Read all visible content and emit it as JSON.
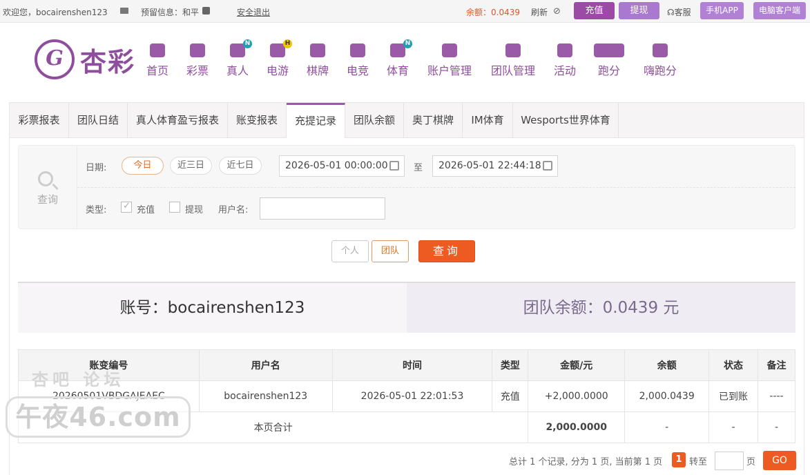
{
  "topbar": {
    "welcome": "欢迎您，bocairenshen123",
    "reserved": "预留信息：和平",
    "logout": "安全退出",
    "balance": "余额：0.0439",
    "refresh": "刷新",
    "deposit": "充值",
    "withdraw": "提现",
    "service": "客服",
    "mobile_app": "手机APP",
    "pc_client": "电脑客户端"
  },
  "logo": {
    "text": "杏彩"
  },
  "nav": [
    {
      "label": "首页",
      "icon": "home-icon"
    },
    {
      "label": "彩票",
      "icon": "lottery-icon"
    },
    {
      "label": "真人",
      "icon": "live-icon",
      "badge": "N"
    },
    {
      "label": "电游",
      "icon": "gamepad-icon",
      "badge": "H"
    },
    {
      "label": "棋牌",
      "icon": "cards-icon"
    },
    {
      "label": "电竞",
      "icon": "esports-icon"
    },
    {
      "label": "体育",
      "icon": "trophy-icon",
      "badge": "N"
    },
    {
      "label": "账户管理",
      "icon": "yen-icon"
    },
    {
      "label": "团队管理",
      "icon": "team-icon"
    },
    {
      "label": "活动",
      "icon": "gift-icon"
    },
    {
      "label": "跑分",
      "icon": "car-icon"
    },
    {
      "label": "嗨跑分",
      "icon": "hi-icon"
    }
  ],
  "tabs": [
    "彩票报表",
    "团队日结",
    "真人体育盈亏报表",
    "账变报表",
    "充提记录",
    "团队余额",
    "奥丁棋牌",
    "IM体育",
    "Wesports世界体育"
  ],
  "active_tab": "充提记录",
  "query": {
    "label": "查询",
    "date_label": "日期:",
    "today": "今日",
    "three_days": "近三日",
    "seven_days": "近七日",
    "start_date": "2026-05-01 00:00:00",
    "to": "至",
    "end_date": "2026-05-01 22:44:18",
    "type_label": "类型:",
    "type_deposit": "充值",
    "type_withdraw": "提现",
    "username_label": "用户名:",
    "username_value": "",
    "personal": "个人",
    "team": "团队",
    "search": "查询"
  },
  "summary": {
    "account": "账号：bocairenshen123",
    "team_balance": "团队余额：0.0439 元"
  },
  "table": {
    "headers": [
      "账变编号",
      "用户名",
      "时间",
      "类型",
      "金额/元",
      "余额",
      "状态",
      "备注"
    ],
    "rows": [
      [
        "20260501VBDGAJEAEC",
        "bocairenshen123",
        "2026-05-01 22:01:53",
        "充值",
        "+2,000.0000",
        "2,000.0439",
        "已到账",
        "----"
      ]
    ],
    "footer_label": "本页合计",
    "footer_amount": "2,000.0000",
    "footer_dash": "-"
  },
  "pager": {
    "summary": "总计 1 个记录, 分为 1 页, 当前第 1 页",
    "current": "1",
    "goto": "转至",
    "page": "页",
    "go": "GO"
  },
  "watermark": {
    "top": "杏吧 论坛",
    "main": "午夜46.com"
  }
}
